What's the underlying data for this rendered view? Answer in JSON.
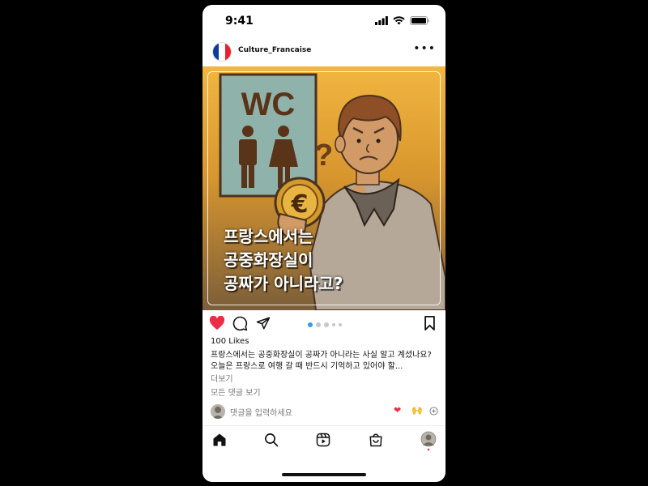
{
  "status": {
    "time": "9:41"
  },
  "post": {
    "username": "Culture_Francaise",
    "more_icon": "more-horizontal-icon",
    "image": {
      "sign_text": "WC",
      "headline": [
        "프랑스에서는",
        "공중화장실이",
        "공짜가 아니라고?"
      ],
      "question_mark": "?"
    },
    "carousel": {
      "count": 5,
      "active": 0
    },
    "likes": "100 Likes",
    "caption": "프랑스에서는 공중화장실이 공짜가 아니라는 사실 알고 계셨나요? 오늘은 프랑스로 여행 갈 때 반드시 기억하고 있어야 할...",
    "more_label": "더보기",
    "all_comments": "모든 댓글 보기",
    "comment_placeholder": "댓글을 입력하세요"
  },
  "colors": {
    "like": "#ed2d48",
    "accent": "#3897f0",
    "flag_blue": "#0a3c9c",
    "flag_white": "#ffffff",
    "flag_red": "#e8202e"
  },
  "tabs": [
    "home-icon",
    "search-icon",
    "reels-icon",
    "shop-icon",
    "profile-avatar"
  ]
}
